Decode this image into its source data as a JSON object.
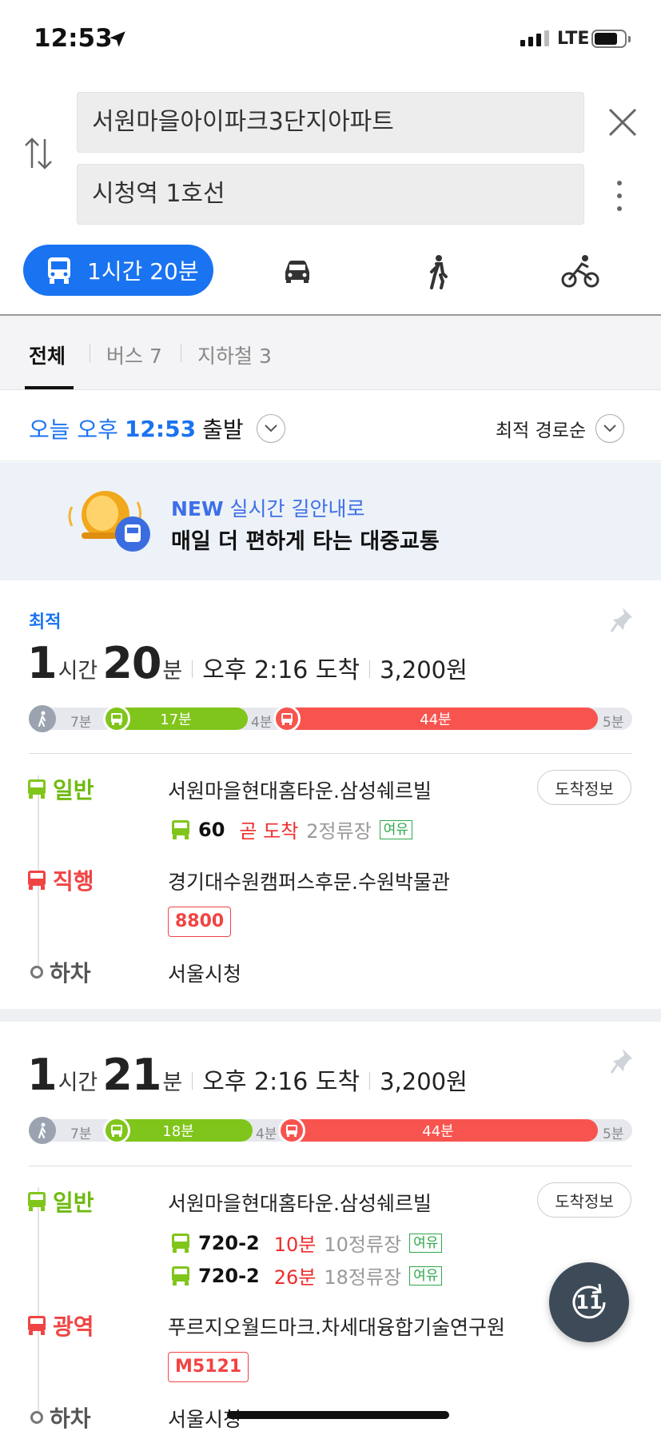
{
  "status": {
    "time": "12:53",
    "network": "LTE"
  },
  "search": {
    "origin": "서원마을아이파크3단지아파트",
    "destination": "시청역 1호선"
  },
  "modes": {
    "transit_duration": "1시간 20분"
  },
  "tabs": [
    {
      "label": "전체"
    },
    {
      "label": "버스 7"
    },
    {
      "label": "지하철 3"
    }
  ],
  "departure": {
    "prefix": "오늘 오후",
    "time": "12:53",
    "suffix": "출발"
  },
  "sort": {
    "label": "최적 경로순"
  },
  "banner": {
    "new": "NEW",
    "title": "실시간 길안내로",
    "subtitle": "매일 더 편하게 타는 대중교통"
  },
  "routes": [
    {
      "badge": "최적",
      "hours": "1",
      "hours_unit": "시간",
      "minutes": "20",
      "minutes_unit": "분",
      "arrival": "오후 2:16 도착",
      "fare": "3,200원",
      "bar": {
        "walk1": "7분",
        "bus1": "17분",
        "walk2": "4분",
        "bus2": "44분",
        "walk3": "5분",
        "bus1_frac": 0.2,
        "bus2_frac": 0.5
      },
      "legs": [
        {
          "type": "일반",
          "stop": "서원마을현대홈타운.삼성쉐르빌",
          "info_btn": "도착정보",
          "buses": [
            {
              "num": "60",
              "eta": "곧 도착",
              "stops": "2정류장",
              "room": "여유"
            }
          ]
        },
        {
          "type": "직행",
          "stop": "경기대수원캠퍼스후문.수원박물관",
          "route_no": "8800"
        },
        {
          "type": "하차",
          "stop": "서울시청"
        }
      ]
    },
    {
      "hours": "1",
      "hours_unit": "시간",
      "minutes": "21",
      "minutes_unit": "분",
      "arrival": "오후 2:16 도착",
      "fare": "3,200원",
      "bar": {
        "walk1": "7분",
        "bus1": "18분",
        "walk2": "4분",
        "bus2": "44분",
        "walk3": "5분",
        "bus1_frac": 0.2,
        "bus2_frac": 0.5
      },
      "legs": [
        {
          "type": "일반",
          "stop": "서원마을현대홈타운.삼성쉐르빌",
          "info_btn": "도착정보",
          "buses": [
            {
              "num": "720-2",
              "eta": "10분",
              "stops": "10정류장",
              "room": "여유"
            },
            {
              "num": "720-2",
              "eta": "26분",
              "stops": "18정류장",
              "room": "여유"
            }
          ]
        },
        {
          "type": "광역",
          "stop": "푸르지오월드마크.차세대융합기술연구원",
          "route_no": "M5121"
        },
        {
          "type": "하차",
          "stop": "서울시청"
        }
      ]
    }
  ],
  "fab": {
    "count": "11"
  },
  "colors": {
    "accent": "#1a73f0",
    "green_bus": "#80c51b",
    "red_bus": "#f7544f"
  }
}
